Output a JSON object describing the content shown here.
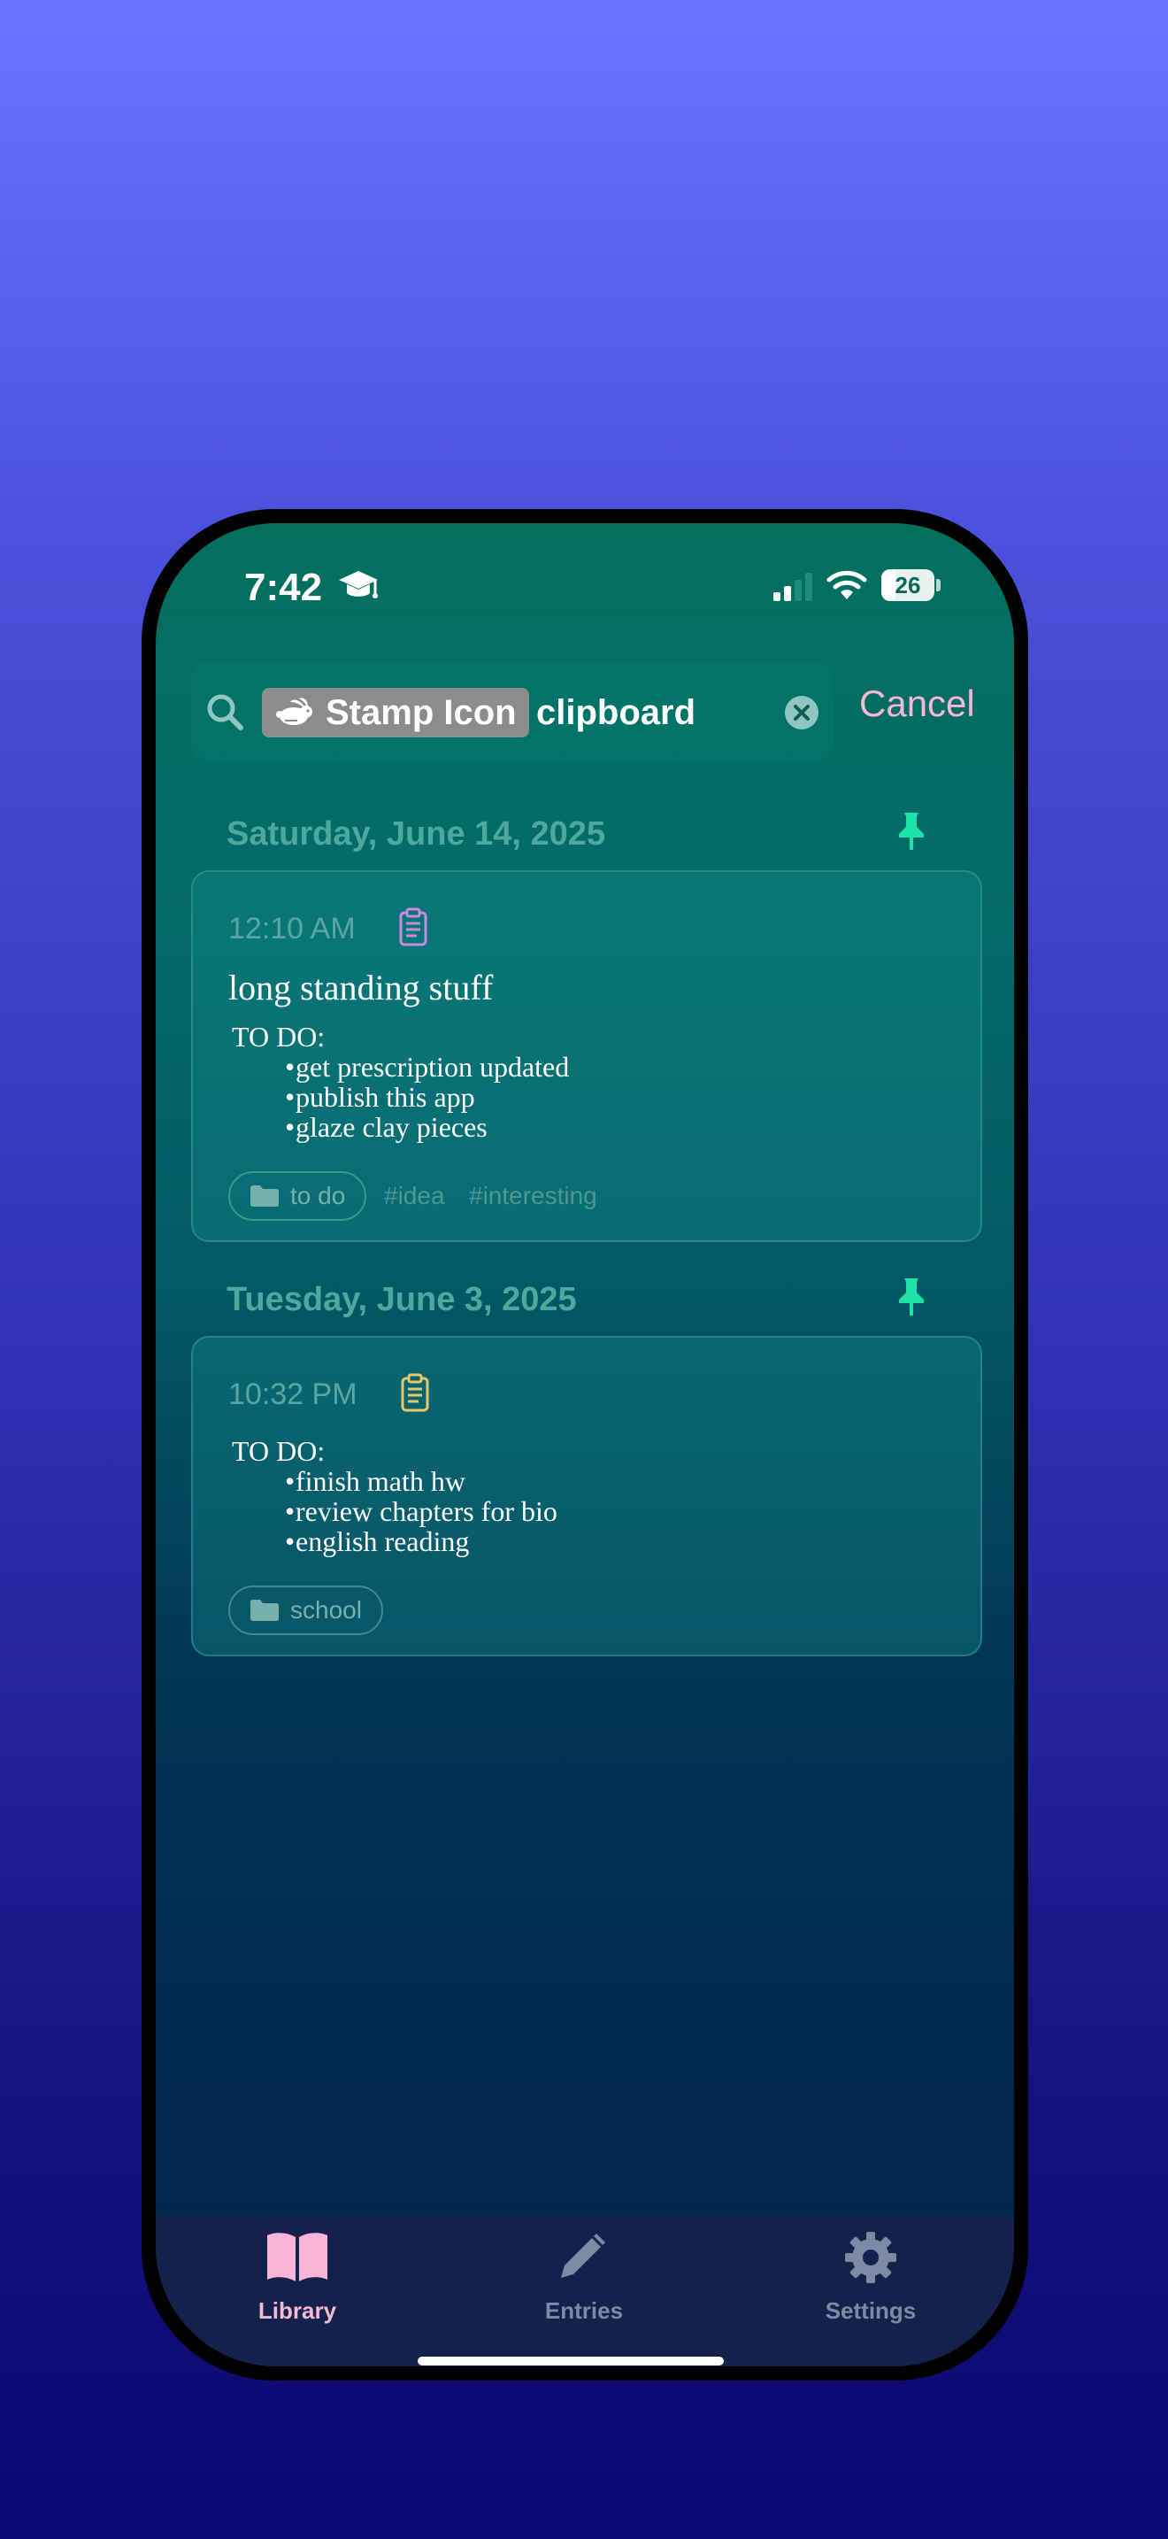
{
  "status_bar": {
    "time": "7:42",
    "battery": "26",
    "battery_percent": 26
  },
  "search": {
    "token_label": "Stamp Icon",
    "query": "clipboard",
    "cancel_label": "Cancel"
  },
  "sections": [
    {
      "date": "Saturday, June 14, 2025",
      "entry": {
        "time": "12:10 AM",
        "title": "long standing stuff",
        "list_heading": "TO DO:",
        "items": [
          "get prescription updated",
          "publish this app",
          "glaze clay pieces"
        ],
        "folder": "to do",
        "tags": [
          "#idea",
          "#interesting"
        ],
        "icon_color": "#c98be0"
      }
    },
    {
      "date": "Tuesday, June 3, 2025",
      "entry": {
        "time": "10:32 PM",
        "list_heading": "TO DO:",
        "items": [
          "finish math hw",
          "review chapters for bio",
          "english reading"
        ],
        "folder": "school",
        "icon_color": "#e6c76a"
      }
    }
  ],
  "tabs": [
    {
      "label": "Library",
      "icon": "book-icon",
      "active": true
    },
    {
      "label": "Entries",
      "icon": "pencil-icon",
      "active": false
    },
    {
      "label": "Settings",
      "icon": "gear-icon",
      "active": false
    }
  ],
  "colors": {
    "accent_pink": "#f7b7d6",
    "pin_green": "#1de3a9",
    "inactive_tab": "#7c8aa6"
  }
}
